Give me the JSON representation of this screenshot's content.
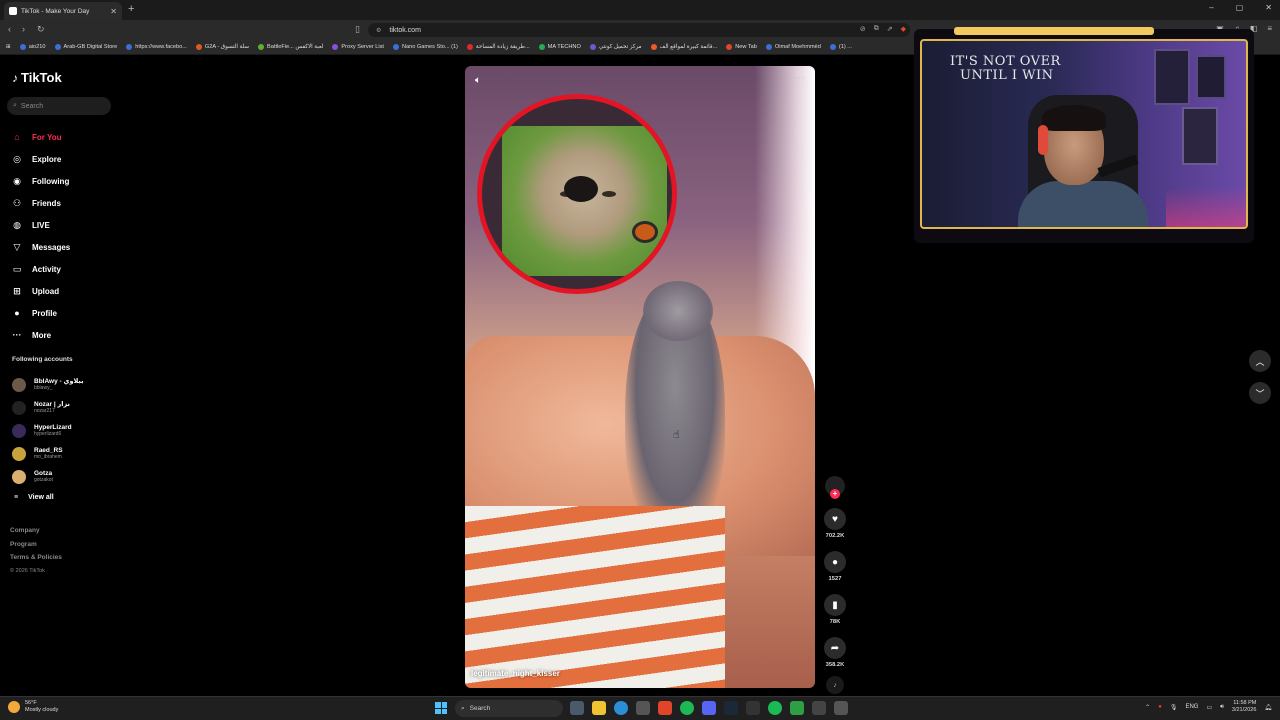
{
  "browser": {
    "tab_title": "TikTok - Make Your Day",
    "new_tab_symbol": "+",
    "url": "tiktok.com",
    "window_controls": [
      "–",
      "▢",
      "✕"
    ],
    "bookmarks": [
      "aio210",
      "Arab-GB Digital Store",
      "https://www.facebo...",
      "G2A - سلة التسوق",
      "BattleFie... لعبة الاكفس",
      "Proxy Server List",
      "Nano Games Sto... (1)",
      "طريقة زيادة المساحة...",
      "MA TECHNO",
      "مركز تحميل كونتي",
      "قائمة كبيرة لمواقع الف...",
      "New Tab",
      "Oimaf Moehmmèd",
      "(1) ..."
    ],
    "bookmarks_overflow": "okmarks"
  },
  "tiktok": {
    "logo_text": "TikTok",
    "search_placeholder": "Search",
    "nav": [
      {
        "label": "For You",
        "icon": "home-icon",
        "glyph": "⌂",
        "active": true
      },
      {
        "label": "Explore",
        "icon": "compass-icon",
        "glyph": "◎",
        "active": false
      },
      {
        "label": "Following",
        "icon": "following-icon",
        "glyph": "◉",
        "active": false
      },
      {
        "label": "Friends",
        "icon": "friends-icon",
        "glyph": "⚇",
        "active": false
      },
      {
        "label": "LIVE",
        "icon": "live-icon",
        "glyph": "◍",
        "active": false
      },
      {
        "label": "Messages",
        "icon": "messages-icon",
        "glyph": "▽",
        "active": false
      },
      {
        "label": "Activity",
        "icon": "activity-icon",
        "glyph": "▭",
        "active": false
      },
      {
        "label": "Upload",
        "icon": "upload-icon",
        "glyph": "⊞",
        "active": false
      },
      {
        "label": "Profile",
        "icon": "profile-icon",
        "glyph": "●",
        "active": false
      },
      {
        "label": "More",
        "icon": "more-icon",
        "glyph": "···",
        "active": false
      }
    ],
    "following_title": "Following accounts",
    "accounts": [
      {
        "name": "BblAwy - ببلاوي",
        "handle": "bblawy_"
      },
      {
        "name": "Nozar | نزار",
        "handle": "nozar217"
      },
      {
        "name": "HyperLizard",
        "handle": "hyperlizard6"
      },
      {
        "name": "Raed_RS",
        "handle": "mo_ibrahem"
      },
      {
        "name": "Gotza",
        "handle": "gotzakot"
      }
    ],
    "view_all": "View all",
    "footer": [
      "Company",
      "Program",
      "Terms & Policies"
    ],
    "copyright": "© 2026 TikTok",
    "video": {
      "caption": "legitimate_night_kisser",
      "likes": "702.2K",
      "comments": "1527",
      "saves": "78K",
      "shares": "358.2K"
    }
  },
  "webcam": {
    "wall_text_line1": "IT'S NOT OVER",
    "wall_text_line2": "UNTIL I WIN"
  },
  "taskbar": {
    "weather_temp": "56°F",
    "weather_desc": "Mostly cloudy",
    "search_label": "Search",
    "language": "ENG",
    "time": "11:58 PM",
    "date": "3/21/2026"
  },
  "colors": {
    "accent": "#fe2c55",
    "pip_ring": "#e31525",
    "webcam_border": "#e0b74f"
  }
}
